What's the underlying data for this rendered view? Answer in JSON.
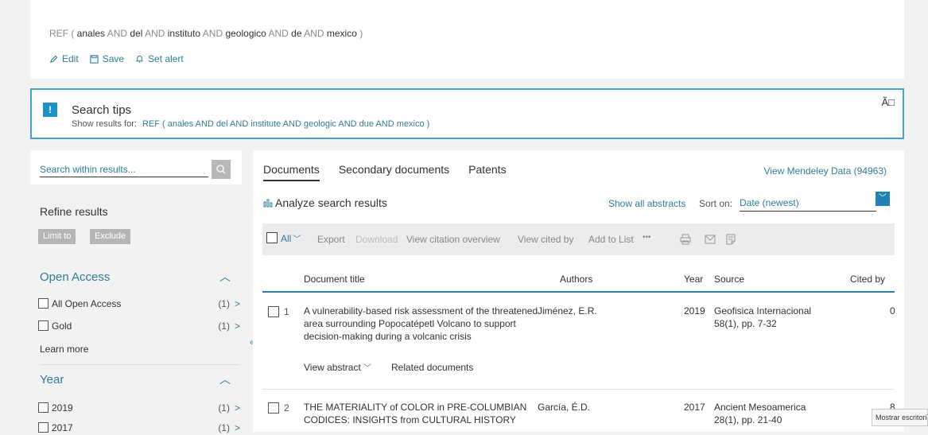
{
  "query": {
    "parts": [
      {
        "t": "REF ( ",
        "k": false
      },
      {
        "t": "anales",
        "k": true
      },
      {
        "t": " AND ",
        "k": false
      },
      {
        "t": "del",
        "k": true
      },
      {
        "t": " AND ",
        "k": false
      },
      {
        "t": "instituto",
        "k": true
      },
      {
        "t": " AND ",
        "k": false
      },
      {
        "t": "geologico",
        "k": true
      },
      {
        "t": " AND ",
        "k": false
      },
      {
        "t": "de",
        "k": true
      },
      {
        "t": " AND ",
        "k": false
      },
      {
        "t": "mexico",
        "k": true
      },
      {
        "t": " )",
        "k": false
      }
    ],
    "edit_label": "Edit",
    "save_label": "Save",
    "alert_label": "Set alert"
  },
  "tips": {
    "icon_text": "!",
    "title": "Search tips",
    "prefix": "Show results for:",
    "suggestion": "REF ( anales  AND del  AND institute  AND geologic  AND due  AND mexico )",
    "close_text": "Ã□"
  },
  "refine": {
    "search_placeholder": "Search within results...",
    "title": "Refine results",
    "limit_label": "Limit to",
    "exclude_label": "Exclude",
    "learn_more": "Learn more",
    "open_access": {
      "title": "Open Access",
      "items": [
        {
          "label": "All Open Access",
          "count": "(1)"
        },
        {
          "label": "Gold",
          "count": "(1)"
        }
      ]
    },
    "year": {
      "title": "Year",
      "items": [
        {
          "label": "2019",
          "count": "(1)"
        },
        {
          "label": "2017",
          "count": "(1)"
        }
      ]
    }
  },
  "main": {
    "tabs": [
      "Documents",
      "Secondary documents",
      "Patents"
    ],
    "mendeley": "View Mendeley Data (94963)",
    "analyze": "Analyze search results",
    "show_abstracts": "Show all abstracts",
    "sort_label": "Sort on:",
    "sort_value": "Date (newest)",
    "toolbar": {
      "all": "All",
      "export": "Export",
      "download": "Download",
      "citation": "View citation overview",
      "cited_by": "View cited by",
      "add_list": "Add to List",
      "more": "•••"
    },
    "headers": {
      "title": "Document title",
      "authors": "Authors",
      "year": "Year",
      "source": "Source",
      "cited": "Cited by"
    },
    "rows": [
      {
        "num": "1",
        "title_lines": [
          "A vulnerability-based risk assessment of the threatened",
          "area surrounding Popocatépetl Volcano to support",
          "decision-making during a volcanic crisis"
        ],
        "authors": "Jiménez, E.R.",
        "year": "2019",
        "source_lines": [
          "Geofisica Internacional",
          "58(1), pp. 7-32"
        ],
        "cited": "0",
        "view_abstract": "View abstract",
        "related": "Related documents"
      },
      {
        "num": "2",
        "title_lines": [
          "THE MATERIALITY of COLOR in PRE-COLUMBIAN",
          "CODICES: INSIGHTS from CULTURAL HISTORY"
        ],
        "authors": "García, É.D.",
        "year": "2017",
        "source_lines": [
          "Ancient Mesoamerica",
          "28(1), pp. 21-40"
        ],
        "cited": "8"
      }
    ]
  },
  "tooltip": "Mostrar escritorio",
  "colors": {
    "accent": "#2e7d9b",
    "tips_border": "#47a0c9",
    "tips_icon": "#1e91c6"
  }
}
